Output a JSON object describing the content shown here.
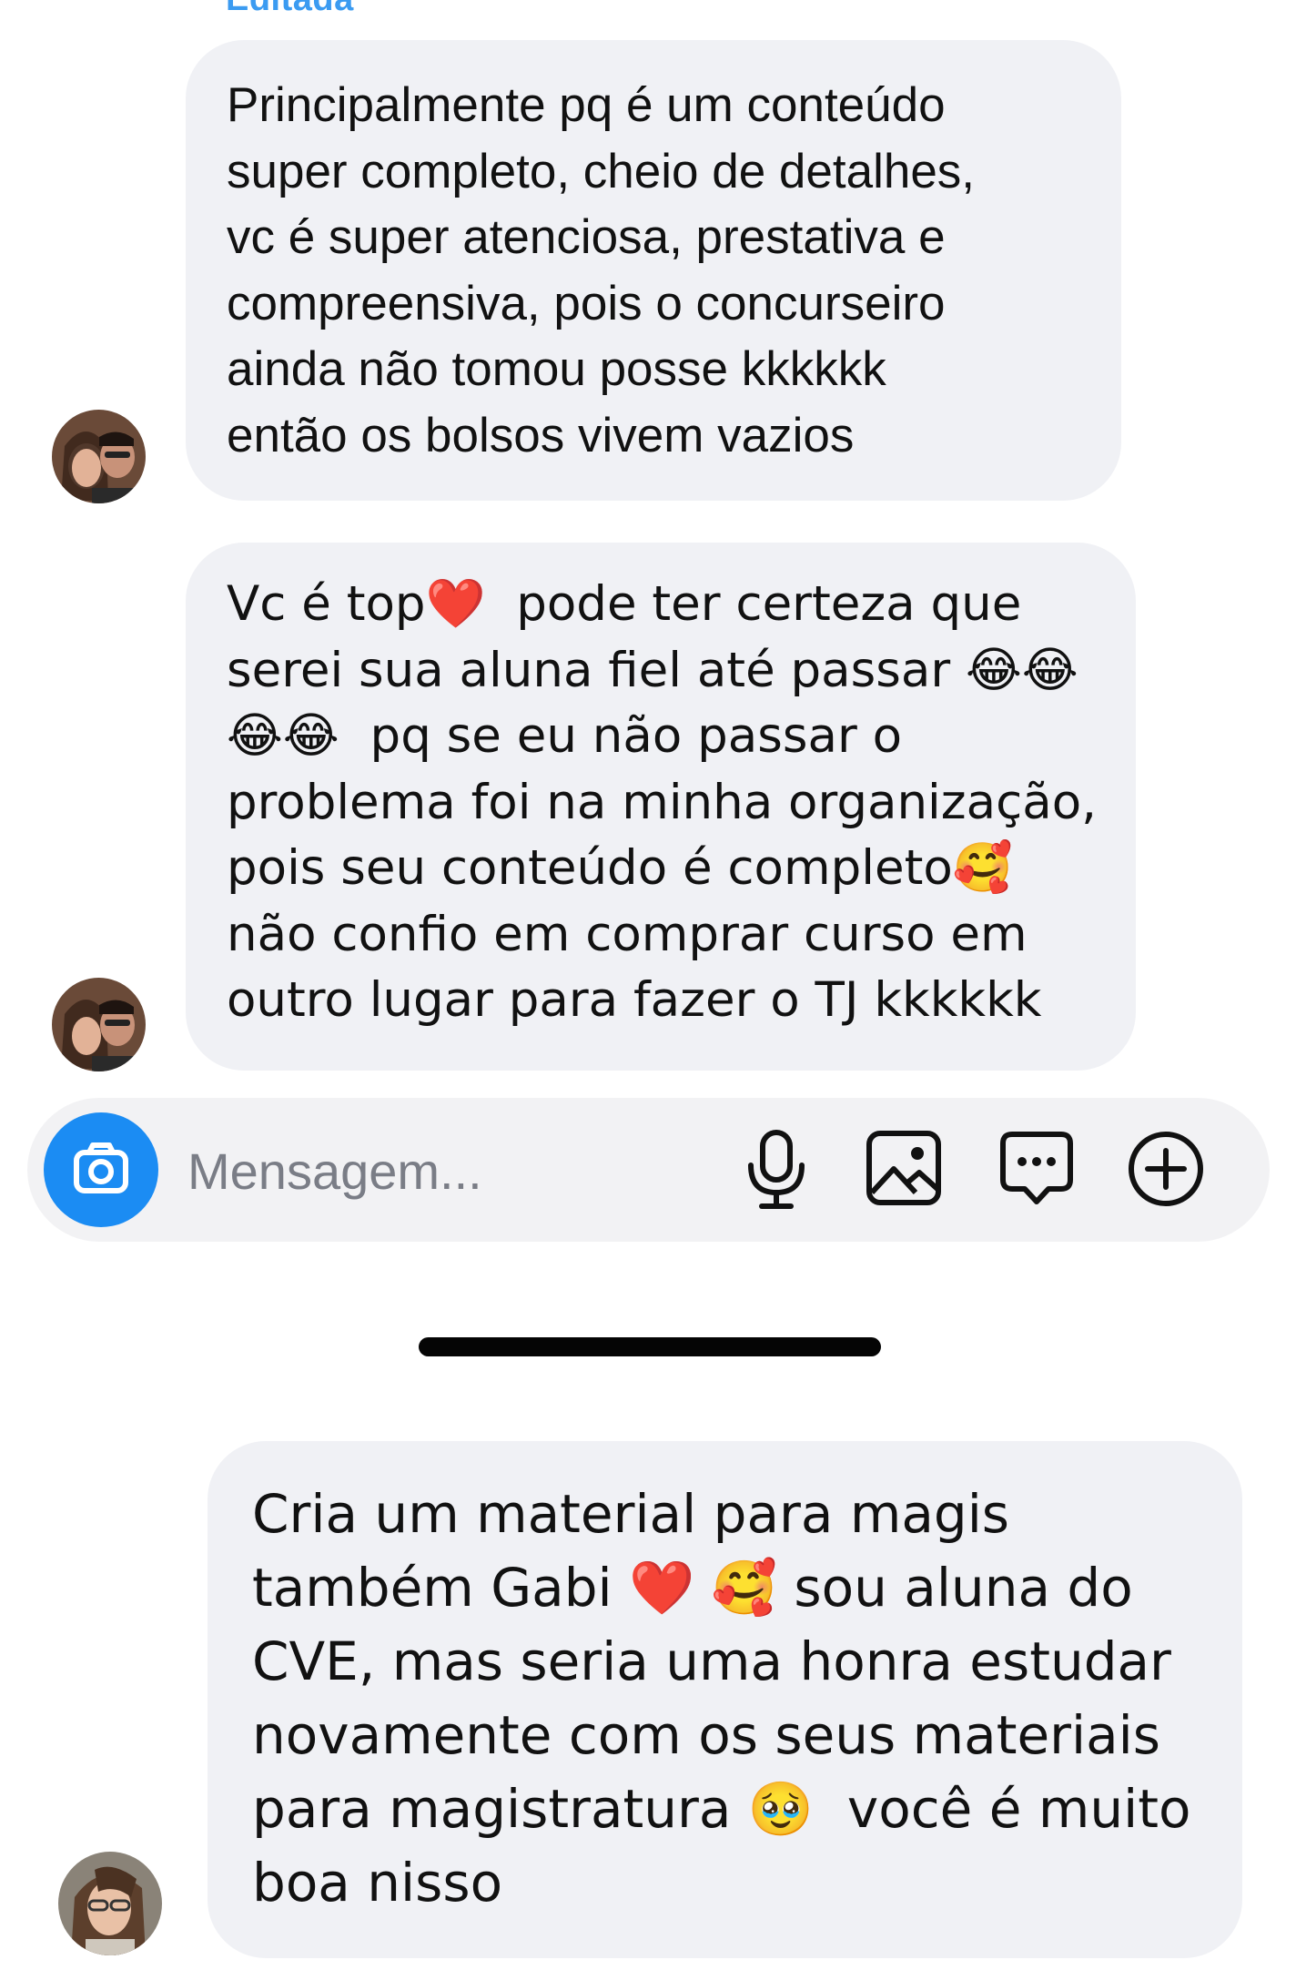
{
  "messages": [
    {
      "status_label": "Editada",
      "lines": [
        "Principalmente pq é um conteúdo",
        "super completo, cheio de detalhes,",
        "vc é super atenciosa, prestativa e",
        "compreensiva, pois o concurseiro",
        "ainda não tomou posse kkkkkk",
        "então os bolsos vivem vazios"
      ]
    },
    {
      "lines": [
        "Vc é top❤️  pode ter certeza que",
        "serei sua aluna fiel até passar 😂😂",
        "😂😂  pq se eu não passar o",
        "problema foi na minha organização,",
        "pois seu conteúdo é completo🥰",
        "não confio em comprar curso em",
        "outro lugar para fazer o TJ kkkkkk"
      ]
    },
    {
      "lines": [
        "Cria um material para magis",
        "também Gabi ❤️ 🥰 sou aluna do",
        "CVE, mas seria uma honra estudar",
        "novamente com os seus materiais",
        "para magistratura 🥹  você é muito",
        "boa nisso"
      ]
    }
  ],
  "composer": {
    "placeholder": "Mensagem...",
    "camera_icon": "camera-icon",
    "tools": [
      "microphone-icon",
      "image-icon",
      "sticker-chat-icon",
      "plus-circle-icon"
    ]
  },
  "colors": {
    "bubble_bg": "#f0f1f5",
    "camera_button": "#1b8cf3",
    "edited_label": "#3b9bf1",
    "composer_bg": "#f2f2f4"
  }
}
